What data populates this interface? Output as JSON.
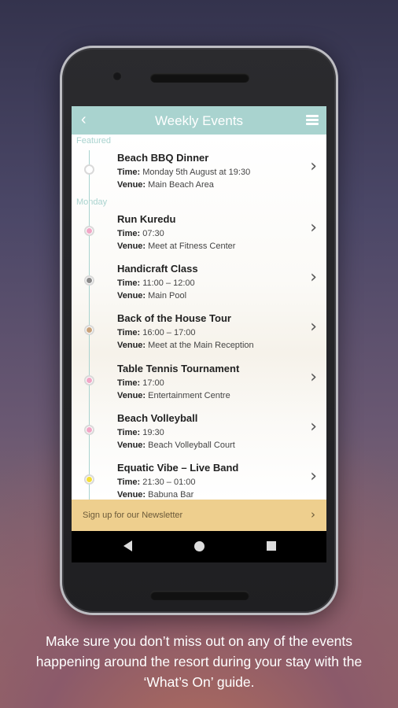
{
  "header": {
    "back_icon": "‹",
    "title": "Weekly Events",
    "menu_icon": "hamburger-menu-icon"
  },
  "sections": {
    "featured": "Featured",
    "monday": "Monday"
  },
  "labels": {
    "time": "Time:",
    "venue": "Venue:"
  },
  "featured_event": {
    "title": "Beach BBQ Dinner",
    "time": "Monday 5th August at 19:30",
    "venue": "Main Beach Area",
    "dot_color": "#d9d9d9"
  },
  "events": [
    {
      "title": "Run Kuredu",
      "time": "07:30",
      "venue": "Meet at Fitness Center",
      "dot_color": "#f1a7c6"
    },
    {
      "title": "Handicraft Class",
      "time": "11:00 – 12:00",
      "venue": "Main Pool",
      "dot_color": "#8a8a8a"
    },
    {
      "title": "Back of the House Tour",
      "time": "16:00 – 17:00",
      "venue": "Meet at the Main Reception",
      "dot_color": "#c9a27a"
    },
    {
      "title": "Table Tennis Tournament",
      "time": "17:00",
      "venue": "Entertainment Centre",
      "dot_color": "#f1a7c6"
    },
    {
      "title": "Beach Volleyball",
      "time": "19:30",
      "venue": "Beach Volleyball Court",
      "dot_color": "#f1a7c6"
    },
    {
      "title": "Equatic Vibe – Live Band",
      "time": "21:30 – 01:00",
      "venue": "Babuna Bar",
      "dot_color": "#f3dd3a"
    }
  ],
  "chevron": "›",
  "newsletter": {
    "label": "Sign up for our Newsletter",
    "arrow": "›"
  },
  "caption": "Make sure you don’t miss out on any of the events happening around the resort during your stay with the ‘What’s On’ guide.",
  "colors": {
    "accent": "#a9d3cf",
    "newsletter_bg": "#eecf8e"
  }
}
